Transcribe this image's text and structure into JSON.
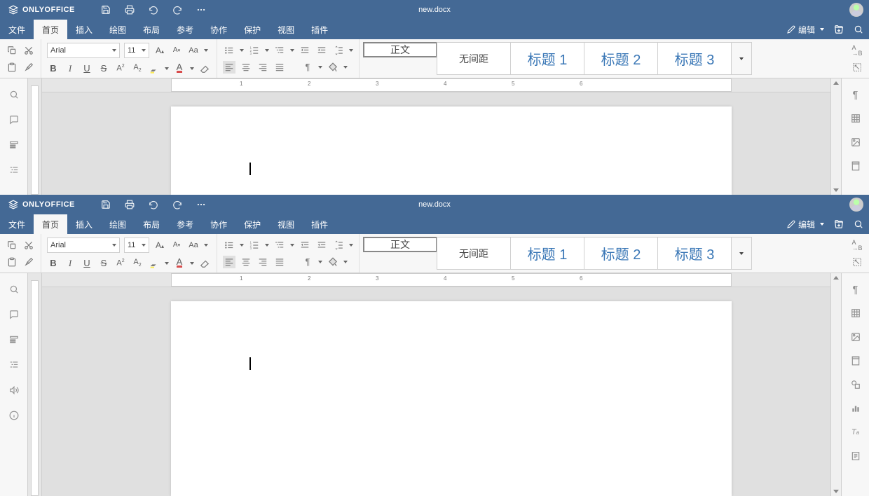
{
  "app_name": "ONLYOFFICE",
  "doc_name": "new.docx",
  "menu": [
    "文件",
    "首页",
    "插入",
    "绘图",
    "布局",
    "参考",
    "协作",
    "保护",
    "视图",
    "插件"
  ],
  "menu_active": 1,
  "mode_label": "编辑",
  "font": {
    "name": "Arial",
    "size": "11"
  },
  "styles": [
    "正文",
    "无间距",
    "标题 1",
    "标题 2",
    "标题 3"
  ],
  "styles_selected": 0,
  "styles_heading_from": 2,
  "ruler_ticks": [
    "1",
    "2",
    "3",
    "4",
    "5",
    "6"
  ]
}
